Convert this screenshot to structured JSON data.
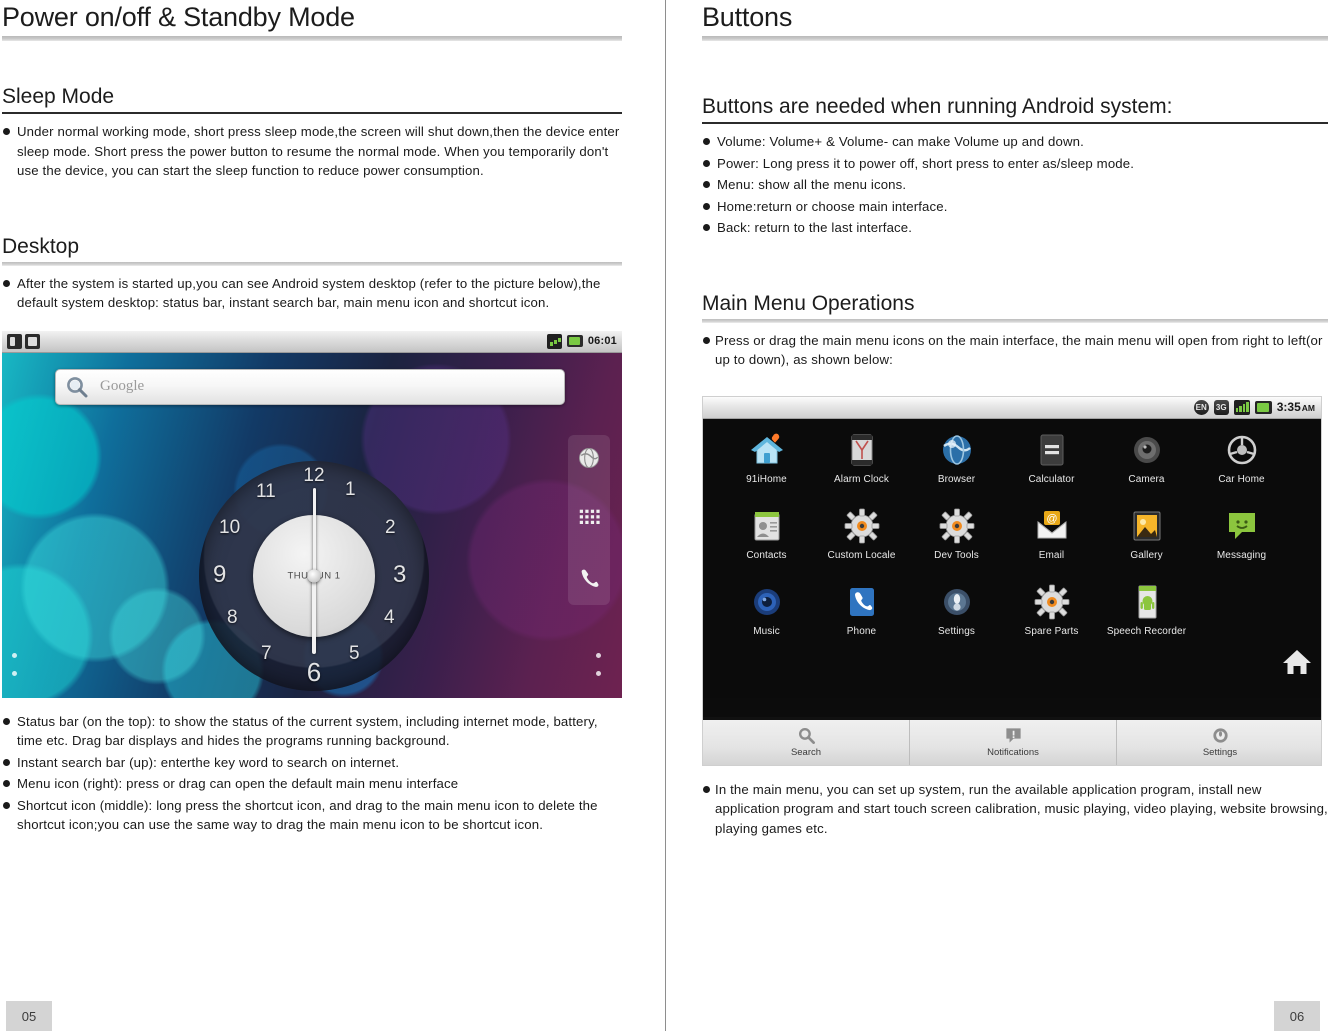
{
  "left_page": {
    "chapter_title": "Power on/off & Standby Mode",
    "sections": [
      {
        "heading": "Sleep Mode",
        "bullets": [
          "Under normal working mode, short press sleep mode,the screen will shut down,then the device enter sleep mode. Short press the power button to resume the normal mode. When you temporarily don't use the device, you can start the sleep function to reduce power consumption."
        ]
      },
      {
        "heading": "Desktop",
        "bullets": [
          "After the system is started up,you can see Android system desktop (refer to the picture below),the default system desktop: status bar, instant search bar, main menu icon and shortcut icon."
        ]
      }
    ],
    "after_image_bullets": [
      "Status bar (on the top): to show the status of the current system, including internet mode, battery, time etc. Drag bar displays and hides the programs running background.",
      "Instant search bar (up): enterthe key word to search on internet.",
      "Menu icon (right): press or drag can open the default main menu interface",
      "Shortcut icon (middle): long press the shortcut icon, and drag to the main menu icon to delete the shortcut icon;you can use the same way to drag the main menu icon to be shortcut icon."
    ],
    "page_number": "05"
  },
  "right_page": {
    "chapter_title": "Buttons",
    "sections": [
      {
        "heading": "Buttons are needed when running Android system:",
        "bullets": [
          "Volume: Volume+ & Volume- can make Volume up and down.",
          "Power: Long press it to power off, short press to enter as/sleep mode.",
          "Menu: show all the menu icons.",
          "Home:return or choose main interface.",
          "Back: return to the last interface."
        ]
      },
      {
        "heading": "Main Menu Operations",
        "bullets": [
          "Press or drag the main menu icons on the main interface, the main menu will open from right to left(or up to down), as shown below:"
        ]
      }
    ],
    "after_image_bullets": [
      "In the main menu, you can set up system, run the available application program, install new application program and start touch screen calibration, music playing, video playing, website browsing, playing games etc."
    ],
    "page_number": "06"
  },
  "home_screenshot": {
    "status_bar": {
      "time": "06:01",
      "left_icons": [
        "usb-icon",
        "sd-card-icon"
      ],
      "right_icons": [
        "signal-icon",
        "battery-icon"
      ]
    },
    "search_widget": {
      "placeholder": "Google",
      "icon": "search-magnifier-icon"
    },
    "clock_widget": {
      "date": "THU  JUN 1",
      "numerals": [
        "12",
        "1",
        "2",
        "3",
        "4",
        "5",
        "6",
        "7",
        "8",
        "9",
        "10",
        "11"
      ]
    },
    "dock_icons": [
      "browser-globe-icon",
      "app-drawer-grid-icon",
      "phone-icon"
    ]
  },
  "menu_screenshot": {
    "status_bar": {
      "time": "3:35",
      "time_suffix": "AM",
      "language_badge": "EN",
      "network_badge": "3G",
      "icons": [
        "signal-icon",
        "battery-icon"
      ]
    },
    "apps": [
      [
        {
          "label": "91iHome",
          "icon": "house-icon"
        },
        {
          "label": "Alarm Clock",
          "icon": "alarm-clock-icon"
        },
        {
          "label": "Browser",
          "icon": "globe-icon"
        },
        {
          "label": "Calculator",
          "icon": "calculator-icon"
        },
        {
          "label": "Camera",
          "icon": "camera-icon"
        },
        {
          "label": "Car Home",
          "icon": "steering-wheel-icon"
        }
      ],
      [
        {
          "label": "Contacts",
          "icon": "contacts-icon"
        },
        {
          "label": "Custom Locale",
          "icon": "gear-icon"
        },
        {
          "label": "Dev Tools",
          "icon": "gear-icon"
        },
        {
          "label": "Email",
          "icon": "envelope-icon"
        },
        {
          "label": "Gallery",
          "icon": "photo-icon"
        },
        {
          "label": "Messaging",
          "icon": "speech-bubble-icon"
        }
      ],
      [
        {
          "label": "Music",
          "icon": "speaker-icon"
        },
        {
          "label": "Phone",
          "icon": "phone-icon"
        },
        {
          "label": "Settings",
          "icon": "settings-dial-icon"
        },
        {
          "label": "Spare Parts",
          "icon": "gear-icon"
        },
        {
          "label": "Speech Recorder",
          "icon": "android-card-icon"
        }
      ]
    ],
    "home_button": "home-icon",
    "bottom_bar": [
      {
        "label": "Search",
        "icon": "search-magnifier-icon"
      },
      {
        "label": "Notifications",
        "icon": "notification-icon"
      },
      {
        "label": "Settings",
        "icon": "settings-dial-icon"
      }
    ]
  }
}
